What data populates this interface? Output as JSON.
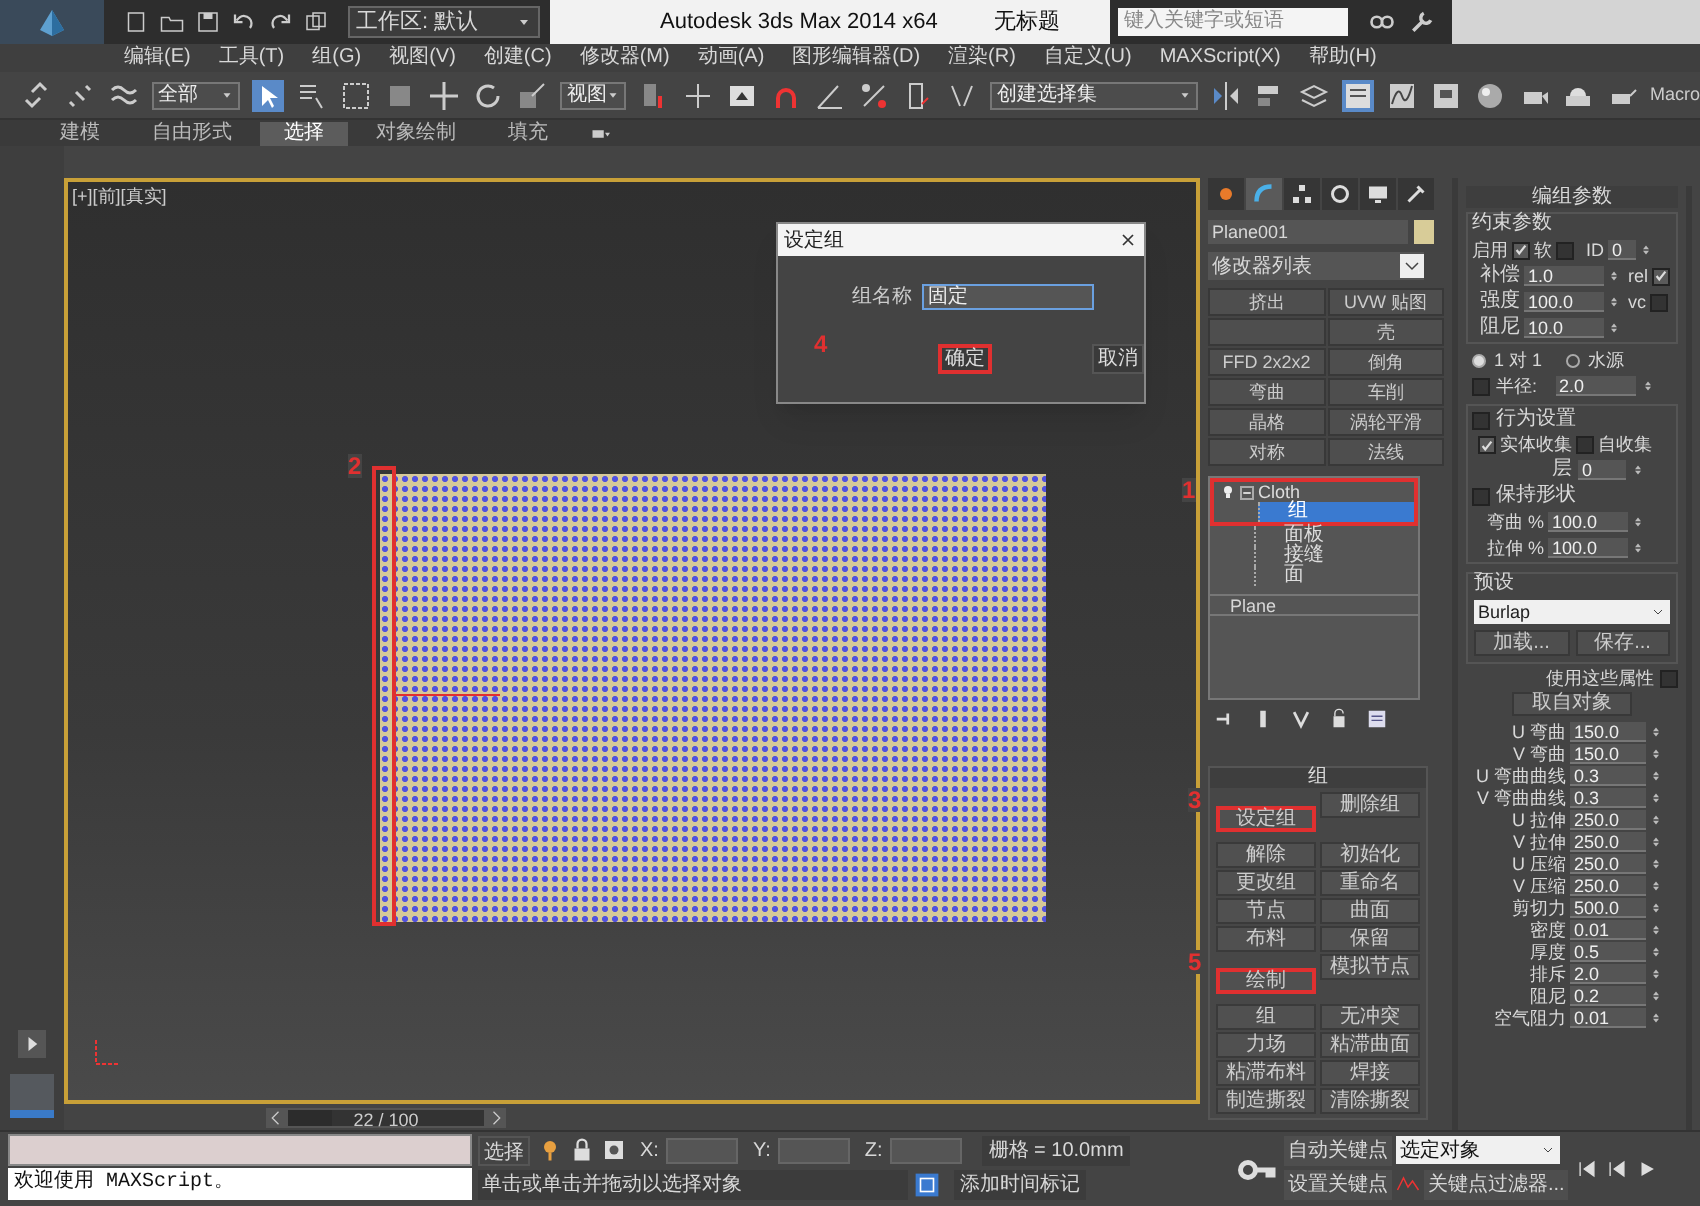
{
  "title_bar": {
    "workspace": "工作区: 默认",
    "title": "Autodesk 3ds Max  2014 x64",
    "document": "无标题",
    "search_placeholder": "键入关键字或短语"
  },
  "menu": [
    "编辑(E)",
    "工具(T)",
    "组(G)",
    "视图(V)",
    "创建(C)",
    "修改器(M)",
    "动画(A)",
    "图形编辑器(D)",
    "渲染(R)",
    "自定义(U)",
    "MAXScript(X)",
    "帮助(H)"
  ],
  "toolbar": {
    "selection_filter": "全部",
    "reference_coord": "视图",
    "selection_set": "创建选择集",
    "macro": "Macro"
  },
  "ribbon_tabs": [
    {
      "label": "建模",
      "selected": false
    },
    {
      "label": "自由形式",
      "selected": false
    },
    {
      "label": "选择",
      "selected": true
    },
    {
      "label": "对象绘制",
      "selected": false
    },
    {
      "label": "填充",
      "selected": false
    }
  ],
  "viewport": {
    "label": "[+][前][真实]",
    "plane_step": "2",
    "timeline": {
      "frame": "22 / 100",
      "level": 0.22
    }
  },
  "dialog": {
    "title": "设定组",
    "field_label": "组名称",
    "field_value": "固定",
    "buttons": [
      {
        "label": "确定",
        "step": "4"
      },
      {
        "label": "取消"
      }
    ]
  },
  "command_panel": {
    "tabs": [
      {
        "selected": false
      },
      {
        "selected": true
      },
      {
        "selected": false
      },
      {
        "selected": false
      },
      {
        "selected": false
      },
      {
        "selected": false
      }
    ],
    "object_name": "Plane001",
    "modifier_list": "修改器列表",
    "modifier_buttons": [
      {
        "kind": "button",
        "label": "挤出"
      },
      {
        "kind": "button",
        "label": "UVW 贴图"
      },
      {
        "kind": "empty"
      },
      {
        "kind": "button",
        "label": "壳"
      },
      {
        "kind": "button",
        "label": "FFD 2x2x2"
      },
      {
        "kind": "button",
        "label": "倒角"
      },
      {
        "kind": "button",
        "label": "弯曲"
      },
      {
        "kind": "button",
        "label": "车削"
      },
      {
        "kind": "button",
        "label": "晶格"
      },
      {
        "kind": "button",
        "label": "涡轮平滑"
      },
      {
        "kind": "button",
        "label": "对称"
      },
      {
        "kind": "button",
        "label": "法线"
      }
    ],
    "stack": [
      {
        "label": "Cloth",
        "expanded": true,
        "step": "1",
        "children": [
          {
            "label": "组",
            "selected": true
          },
          {
            "label": "面板",
            "selected": false
          },
          {
            "label": "接缝",
            "selected": false
          },
          {
            "label": "面",
            "selected": false
          }
        ]
      },
      {
        "label": "Plane"
      }
    ],
    "group_rollout": {
      "title": "组",
      "buttons": [
        {
          "label": "设定组",
          "step": "3"
        },
        {
          "label": "删除组"
        },
        {
          "label": "解除"
        },
        {
          "label": "初始化"
        },
        {
          "label": "更改组"
        },
        {
          "label": "重命名"
        },
        {
          "label": "节点"
        },
        {
          "label": "曲面"
        },
        {
          "label": "布料"
        },
        {
          "label": "保留"
        },
        {
          "label": "绘制",
          "step": "5"
        },
        {
          "label": "模拟节点"
        },
        {
          "label": "组"
        },
        {
          "label": "无冲突"
        },
        {
          "label": "力场"
        },
        {
          "label": "粘滞曲面"
        },
        {
          "label": "粘滞布料"
        },
        {
          "label": "焊接"
        },
        {
          "label": "制造撕裂"
        },
        {
          "label": "清除撕裂"
        }
      ]
    }
  },
  "group_params": {
    "title": "编组参数",
    "constraint": {
      "title": "约束参数",
      "enable": {
        "label": "启用",
        "checked": true
      },
      "soft": {
        "label": "软",
        "checked": false
      },
      "id": {
        "label": "ID",
        "value": "0"
      },
      "spinners": [
        {
          "label": "补偿",
          "value": "1.0",
          "check": {
            "label": "rel",
            "checked": true
          }
        },
        {
          "label": "强度",
          "value": "100.0",
          "check": {
            "label": "vc",
            "checked": false
          }
        },
        {
          "label": "阻尼",
          "value": "10.0"
        }
      ]
    },
    "mode_radios": [
      {
        "label": "1 对 1",
        "selected": true
      },
      {
        "label": "水源",
        "selected": false
      }
    ],
    "radius": {
      "label": "半径:",
      "checked": false,
      "value": "2.0"
    },
    "behavior": {
      "label": "行为设置",
      "checked": false,
      "solid": {
        "label": "实体收集",
        "checked": true
      },
      "self": {
        "label": "自收集",
        "checked": false
      },
      "layer": {
        "label": "层",
        "value": "0"
      },
      "keep_shape": {
        "label": "保持形状",
        "checked": false
      },
      "spinners": [
        {
          "label": "弯曲 %",
          "value": "100.0"
        },
        {
          "label": "拉伸 %",
          "value": "100.0"
        }
      ]
    },
    "preset": {
      "title": "预设",
      "value": "Burlap",
      "buttons": [
        "加载...",
        "保存..."
      ]
    },
    "use_props": {
      "label": "使用这些属性",
      "checked": false
    },
    "take_from": "取自对象",
    "properties": [
      {
        "label": "U 弯曲",
        "value": "150.0"
      },
      {
        "label": "V 弯曲",
        "value": "150.0"
      },
      {
        "label": "U 弯曲曲线",
        "value": "0.3"
      },
      {
        "label": "V 弯曲曲线",
        "value": "0.3"
      },
      {
        "label": "U 拉伸",
        "value": "250.0"
      },
      {
        "label": "V 拉伸",
        "value": "250.0"
      },
      {
        "label": "U 压缩",
        "value": "250.0"
      },
      {
        "label": "V 压缩",
        "value": "250.0"
      },
      {
        "label": "剪切力",
        "value": "500.0"
      },
      {
        "label": "密度",
        "value": "0.01"
      },
      {
        "label": "厚度",
        "value": "0.5"
      },
      {
        "label": "排斥",
        "value": "2.0"
      },
      {
        "label": "阻尼",
        "value": "0.2"
      },
      {
        "label": "空气阻力",
        "value": "0.01"
      }
    ]
  },
  "status_bar": {
    "script_output": "欢迎使用 MAXScript。",
    "mode": "选择",
    "coords": [
      "X:",
      "Y:",
      "Z:"
    ],
    "grid": "栅格 = 10.0mm",
    "prompt": "单击或单击并拖动以选择对象",
    "time_tag": "添加时间标记",
    "auto_key": "自动关键点",
    "set_key": "设置关键点",
    "key_target": "选定对象",
    "key_filters": "关键点过滤器..."
  }
}
